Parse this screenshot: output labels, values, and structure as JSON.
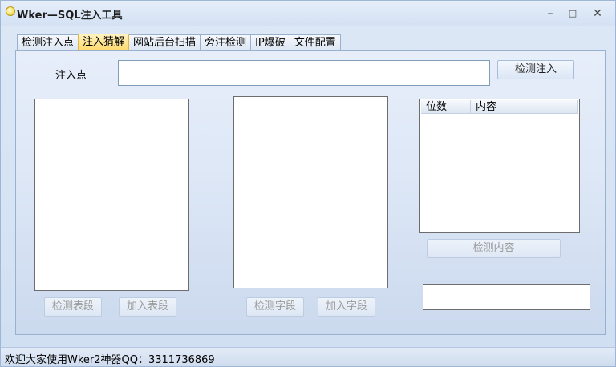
{
  "window": {
    "title": "Wker—SQL注入工具",
    "minimize": "–",
    "maximize": "□",
    "close": "✕"
  },
  "tabs": [
    {
      "label": "检测注入点",
      "active": false
    },
    {
      "label": "注入猜解",
      "active": true
    },
    {
      "label": "网站后台扫描",
      "active": false
    },
    {
      "label": "旁注检测",
      "active": false
    },
    {
      "label": "IP爆破",
      "active": false
    },
    {
      "label": "文件配置",
      "active": false
    }
  ],
  "injection": {
    "label": "注入点",
    "value": "",
    "detect_button": "检测注入"
  },
  "tables": {
    "detect_button": "检测表段",
    "add_button": "加入表段"
  },
  "fields": {
    "detect_button": "检测字段",
    "add_button": "加入字段"
  },
  "content": {
    "columns": [
      "位数",
      "内容"
    ],
    "detect_button": "检测内容",
    "result_value": ""
  },
  "status": {
    "text": "欢迎大家使用Wker2神器QQ：3311736869"
  }
}
